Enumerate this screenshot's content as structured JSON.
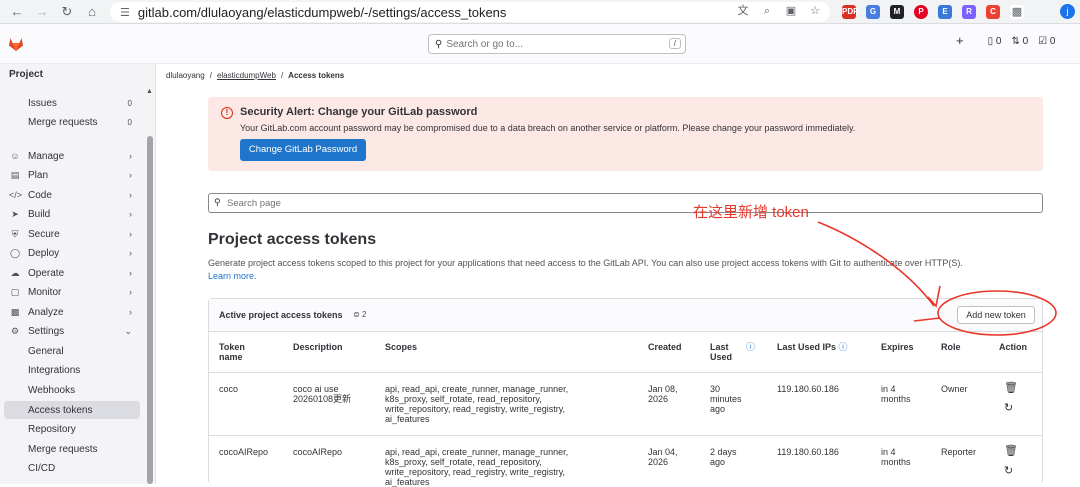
{
  "browser": {
    "url": "gitlab.com/dlulaoyang/elasticdumpweb/-/settings/access_tokens",
    "profile_initial": "j",
    "extensions": [
      "PDF",
      "G",
      "M",
      "P",
      "E",
      "R",
      "C"
    ]
  },
  "topbar": {
    "search_placeholder": "Search or go to...",
    "search_shortcut": "/",
    "plus": "+",
    "issues_count": "0",
    "mr_count": "0",
    "todo_count": "0"
  },
  "sidebar": {
    "heading": "Project",
    "sub_items": [
      {
        "label": "Issues",
        "count": "0"
      },
      {
        "label": "Merge requests",
        "count": "0"
      }
    ],
    "items": [
      {
        "label": "Manage"
      },
      {
        "label": "Plan"
      },
      {
        "label": "Code"
      },
      {
        "label": "Build"
      },
      {
        "label": "Secure"
      },
      {
        "label": "Deploy"
      },
      {
        "label": "Operate"
      },
      {
        "label": "Monitor"
      },
      {
        "label": "Analyze"
      },
      {
        "label": "Settings"
      }
    ],
    "settings_items": [
      {
        "label": "General"
      },
      {
        "label": "Integrations"
      },
      {
        "label": "Webhooks"
      },
      {
        "label": "Access tokens"
      },
      {
        "label": "Repository"
      },
      {
        "label": "Merge requests"
      },
      {
        "label": "CI/CD"
      }
    ]
  },
  "breadcrumb": {
    "owner": "dlulaoyang",
    "project": "elasticdumpWeb",
    "current": "Access tokens"
  },
  "alert": {
    "title": "Security Alert: Change your GitLab password",
    "body": "Your GitLab.com account password may be compromised due to a data breach on another service or platform. Please change your password immediately.",
    "button": "Change GitLab Password"
  },
  "search_page_placeholder": "Search page",
  "section": {
    "title": "Project access tokens",
    "description": "Generate project access tokens scoped to this project for your applications that need access to the GitLab API. You can also use project access tokens with Git to authenticate over HTTP(S).",
    "learn_more": "Learn more."
  },
  "tokens_card": {
    "title": "Active project access tokens",
    "count": "2",
    "add_button": "Add new token",
    "headers": {
      "name": [
        "Token",
        "name"
      ],
      "description": "Description",
      "scopes": "Scopes",
      "created": "Created",
      "last_used": [
        "Last",
        "Used"
      ],
      "last_used_ips": "Last Used IPs",
      "expires": "Expires",
      "role": "Role",
      "action": "Action"
    },
    "rows": [
      {
        "name": "coco",
        "description": [
          "coco ai use",
          "20260108更新"
        ],
        "scopes": [
          "api, read_api, create_runner, manage_runner,",
          "k8s_proxy, self_rotate, read_repository,",
          "write_repository, read_registry, write_registry,",
          "ai_features"
        ],
        "created": [
          "Jan 08,",
          "2026"
        ],
        "last_used": [
          "30",
          "minutes",
          "ago"
        ],
        "ips": "119.180.60.186",
        "expires": [
          "in 4",
          "months"
        ],
        "role": "Owner"
      },
      {
        "name": "cocoAIRepo",
        "description": [
          "cocoAIRepo"
        ],
        "scopes": [
          "api, read_api, create_runner, manage_runner,",
          "k8s_proxy, self_rotate, read_repository,",
          "write_repository, read_registry, write_registry,",
          "ai_features"
        ],
        "created": [
          "Jan 04,",
          "2026"
        ],
        "last_used": [
          "2 days",
          "ago"
        ],
        "ips": "119.180.60.186",
        "expires": [
          "in 4",
          "months"
        ],
        "role": "Reporter"
      }
    ]
  },
  "annotation": {
    "text": "在这里新增 token",
    "color": "#e8372b"
  },
  "colors": {
    "primary_button": "#1f75cb",
    "alert_bg": "#fce9e5",
    "alert_icon": "#dd2b0e",
    "sidebar_bg": "#f4f4f6",
    "active_item": "#dbdbe2"
  }
}
